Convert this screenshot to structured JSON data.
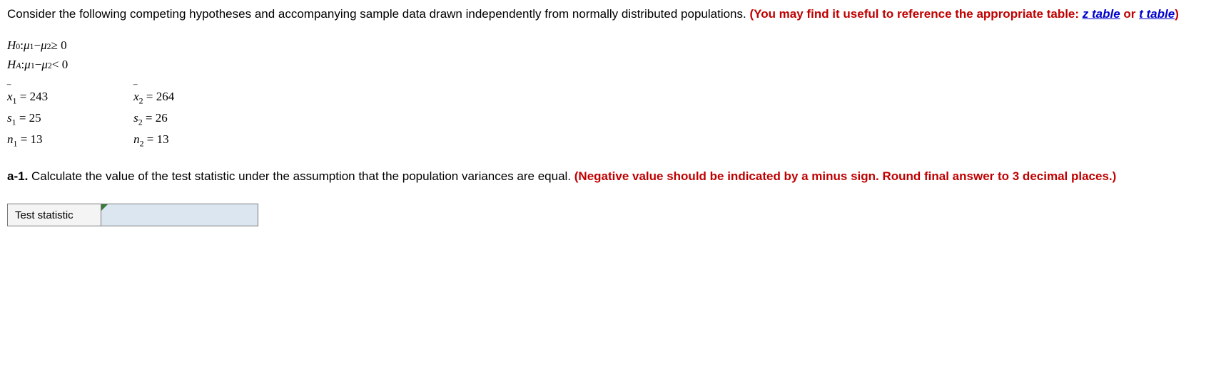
{
  "intro": {
    "line1": "Consider the following competing hypotheses and accompanying sample data drawn independently from normally distributed populations. ",
    "note_prefix": "(You may find it useful to reference the appropriate table: ",
    "z_link": "z table",
    "or_text": " or ",
    "t_link": "t table",
    "note_suffix": ")"
  },
  "hypotheses": {
    "h0_label": "H",
    "h0_sub": "0",
    "h0_colon": ": ",
    "mu": "μ",
    "sub1": "1",
    "sub2": "2",
    "minus": " − ",
    "h0_rel": " ≥ 0",
    "ha_label": "H",
    "ha_sub": "A",
    "ha_rel": " < 0"
  },
  "sample": {
    "col1": {
      "xbar": "x",
      "xbar_sub": "1",
      "xbar_eq": " = ",
      "xbar_val": "243",
      "s": "s",
      "s_sub": "1",
      "s_eq": " = ",
      "s_val": "25",
      "n": "n",
      "n_sub": "1",
      "n_eq": " = ",
      "n_val": "13"
    },
    "col2": {
      "xbar": "x",
      "xbar_sub": "2",
      "xbar_eq": " = ",
      "xbar_val": "264",
      "s": "s",
      "s_sub": "2",
      "s_eq": " = ",
      "s_val": "26",
      "n": "n",
      "n_sub": "2",
      "n_eq": " = ",
      "n_val": "13"
    }
  },
  "question": {
    "label": "a-1.",
    "text": " Calculate the value of the test statistic under the assumption that the population variances are equal. ",
    "note": "(Negative value should be indicated by a minus sign. Round final answer to 3 decimal places.)"
  },
  "answer": {
    "label": "Test statistic",
    "value": ""
  }
}
